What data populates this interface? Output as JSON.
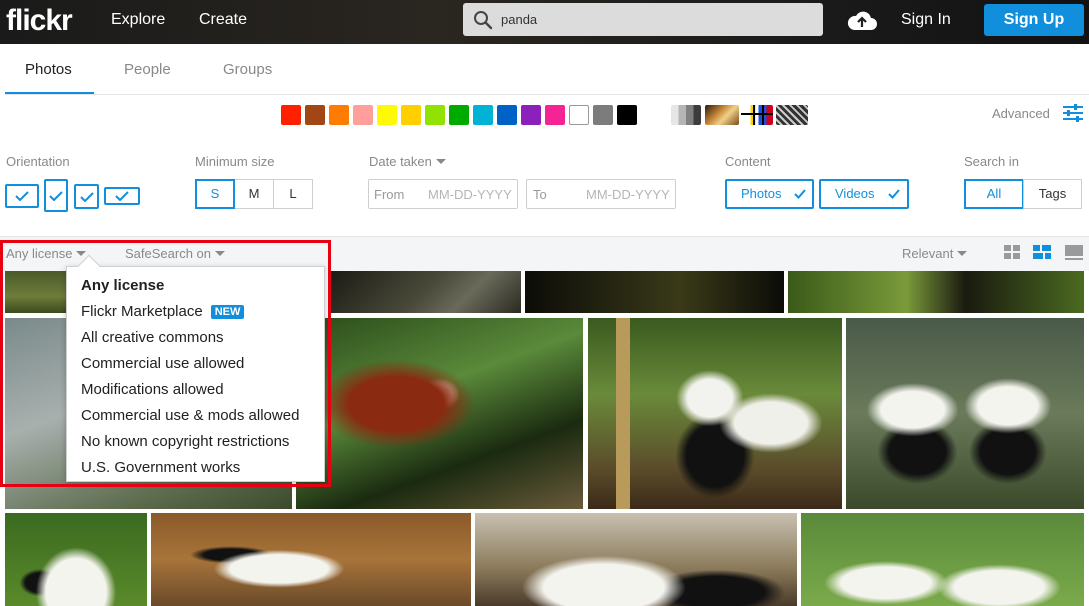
{
  "nav": {
    "logo": "flickr",
    "explore": "Explore",
    "create": "Create",
    "search_value": "panda",
    "sign_in": "Sign In",
    "sign_up": "Sign Up"
  },
  "tabs": [
    {
      "label": "Photos",
      "active": true
    },
    {
      "label": "People",
      "active": false
    },
    {
      "label": "Groups",
      "active": false
    }
  ],
  "colors": [
    "#ff2000",
    "#a24615",
    "#ff7c00",
    "#ff9f9c",
    "#fffa00",
    "#ffcf00",
    "#90e200",
    "#00ab00",
    "#00b2d4",
    "#0062c6",
    "#8c20ba",
    "#f52394",
    "#ffffff",
    "#7c7c7c",
    "#000000"
  ],
  "advanced_label": "Advanced",
  "filters": {
    "orientation_label": "Orientation",
    "min_size_label": "Minimum size",
    "sizes": [
      "S",
      "M",
      "L"
    ],
    "selected_size": "S",
    "date_taken_label": "Date taken",
    "from_label": "From",
    "from_placeholder": "MM-DD-YYYY",
    "to_label": "To",
    "to_placeholder": "MM-DD-YYYY",
    "content_label": "Content",
    "content_photos": "Photos",
    "content_videos": "Videos",
    "search_in_label": "Search in",
    "search_in_all": "All",
    "search_in_tags": "Tags"
  },
  "sortbar": {
    "license": "Any license",
    "safesearch": "SafeSearch on",
    "sort": "Relevant"
  },
  "license_menu": {
    "items": [
      "Any license",
      "Flickr Marketplace",
      "All creative commons",
      "Commercial use allowed",
      "Modifications allowed",
      "Commercial use & mods allowed",
      "No known copyright restrictions",
      "U.S. Government works"
    ],
    "new_badge": "NEW",
    "selected": "Any license"
  }
}
